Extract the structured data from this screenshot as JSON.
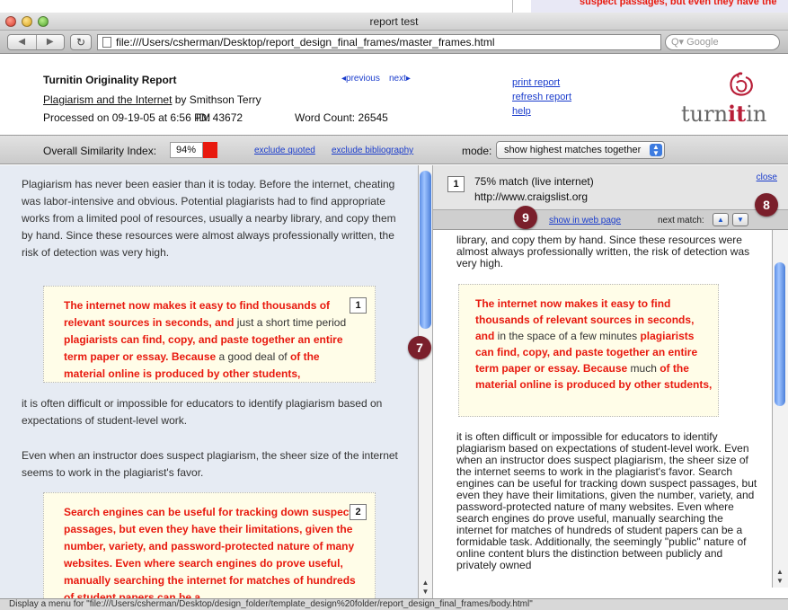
{
  "background_peek": {
    "text": "suspect passages, but even they have the"
  },
  "window": {
    "title": "report test"
  },
  "toolbar": {
    "back_glyph": "◀",
    "forward_glyph": "▶",
    "reload_glyph": "↻",
    "url": "file:///Users/csherman/Desktop/report_design_final_frames/master_frames.html",
    "search_placeholder": "Q▾ Google"
  },
  "report": {
    "title": "Turnitin Originality Report",
    "paper_title": "Plagiarism and the Internet",
    "paper_author": " by Smithson Terry",
    "processed": "Processed on 09-19-05 at 6:56 PM",
    "id": "ID: 43672",
    "word_count": "Word Count: 26545",
    "previous": "◂previous",
    "next": "next▸",
    "links": [
      "print report",
      "refresh report",
      "help"
    ],
    "logo_pre": "turn",
    "logo_bold": "it",
    "logo_post": "in"
  },
  "similarity": {
    "label": "Overall Similarity Index:",
    "value": "94%",
    "swatch_color": "#e8190e",
    "exclude_quoted": "exclude quoted",
    "exclude_bibliography": "exclude bibliography",
    "mode_label": "mode:",
    "mode_value": "show highest matches together"
  },
  "left": {
    "para1": "Plagiarism has never been easier than it is today. Before the internet, cheating was labor-intensive and obvious. Potential plagiarists had to find appropriate works from a limited pool of resources, usually a nearby library, and copy them by hand. Since these resources were almost always professionally written, the risk of detection was very high.",
    "match1": {
      "number": "1",
      "a": "The internet now makes it easy to find thousands of relevant sources in seconds, and",
      "b": " just a short time period ",
      "c": "plagiarists can find, copy, and paste together an entire term paper or essay. Because",
      "d": " a good deal of ",
      "e": "of the material online is produced by other students,"
    },
    "para2": "it is often difficult or impossible for educators to identify plagiarism based on expectations of student-level work.",
    "para3": "Even when an instructor does suspect plagiarism, the sheer size of the internet seems to work in the plagiarist's favor.",
    "match2": {
      "number": "2",
      "text": "Search engines can be useful for tracking down suspect passages, but even they have their limitations, given the number, variety, and password-protected nature of many websites. Even where search engines do prove useful, manually searching the internet for matches of hundreds of student papers can be a"
    }
  },
  "right": {
    "number": "1",
    "match_line": "75% match (live internet)",
    "url": "http://www.craigslist.org",
    "close": "close",
    "show_in_web": "show in web page",
    "next_match": "next match:",
    "up_glyph": "▲",
    "down_glyph": "▼",
    "top_text": "library, and copy them by hand. Since these resources were almost always professionally written, the risk of detection was very high.",
    "match": {
      "a": "The internet now makes it easy to find thousands of relevant sources in seconds, and",
      "b": " in the space of a few minutes ",
      "c": "plagiarists can find, copy, and paste together an entire term paper or essay. Because",
      "d": " much ",
      "e": "of the material online is produced by other students,"
    },
    "bottom_text": "it is often difficult or impossible for educators to identify plagiarism based on expectations of student-level work. Even when an instructor does suspect plagiarism, the sheer size of the internet seems to work in the plagiarist's favor. Search engines can be useful for tracking down suspect passages, but even they have their limitations, given the number, variety, and password-protected nature of many websites. Even where search engines do prove useful, manually searching the internet for matches of hundreds of student papers can be a formidable task. Additionally, the seemingly \"public\" nature of online content blurs the distinction between publicly and privately owned"
  },
  "callouts": {
    "seven": "7",
    "eight": "8",
    "nine": "9"
  },
  "status": "Display a menu for \"file:///Users/csherman/Desktop/design_folder/template_design%20folder/report_design_final_frames/body.html\""
}
